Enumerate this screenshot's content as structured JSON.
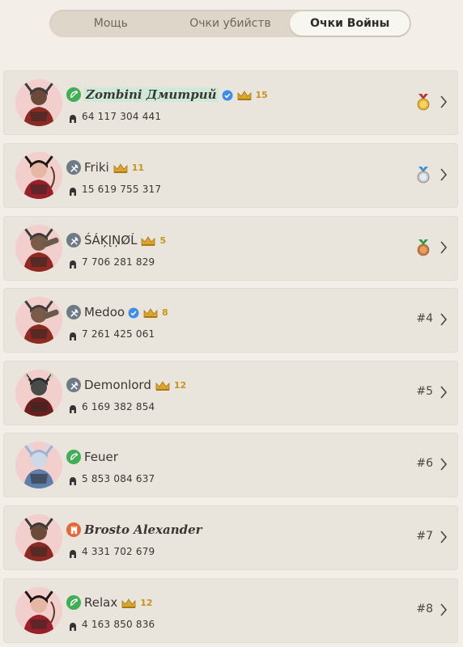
{
  "tabs": [
    {
      "label": "Мощь",
      "active": false
    },
    {
      "label": "Очки убийств",
      "active": false
    },
    {
      "label": "Очки Войны",
      "active": true
    }
  ],
  "players": [
    {
      "name": "Zombini Дмитрий",
      "score": "64 117 304 441",
      "level": "15",
      "rank": "",
      "medal": "gold",
      "class": "archer",
      "class_color": "#3fae55",
      "verified": true,
      "crown": true,
      "avatar": "horned-warrior",
      "name_style": "fancy-highlight"
    },
    {
      "name": "Friki",
      "score": "15 619 755 317",
      "level": "11",
      "rank": "",
      "medal": "silver",
      "class": "axe",
      "class_color": "#6e7b86",
      "verified": false,
      "crown": true,
      "avatar": "red-archer",
      "name_style": "plain"
    },
    {
      "name": "ŚÁĶĮŅØĹ",
      "score": "7 706 281 829",
      "level": "5",
      "rank": "",
      "medal": "bronze",
      "class": "axe",
      "class_color": "#6e7b86",
      "verified": false,
      "crown": true,
      "avatar": "cannon-warrior",
      "name_style": "plain"
    },
    {
      "name": "Medoo",
      "score": "7 261 425 061",
      "level": "8",
      "rank": "#4",
      "medal": "",
      "class": "axe",
      "class_color": "#6e7b86",
      "verified": true,
      "crown": true,
      "avatar": "cannon-warrior",
      "name_style": "plain"
    },
    {
      "name": "Demonlord",
      "score": "6 169 382 854",
      "level": "12",
      "rank": "#5",
      "medal": "",
      "class": "axe",
      "class_color": "#6e7b86",
      "verified": false,
      "crown": true,
      "avatar": "minotaur",
      "name_style": "plain"
    },
    {
      "name": "Feuer",
      "score": "5 853 084 637",
      "level": "",
      "rank": "#6",
      "medal": "",
      "class": "archer",
      "class_color": "#3fae55",
      "verified": false,
      "crown": false,
      "avatar": "blue-warrior",
      "name_style": "plain"
    },
    {
      "name": "Brosto Alexander",
      "score": "4 331 702 679",
      "level": "",
      "rank": "#7",
      "medal": "",
      "class": "tower",
      "class_color": "#e4683a",
      "verified": false,
      "crown": false,
      "avatar": "horned-warrior",
      "name_style": "fancy"
    },
    {
      "name": "Relax",
      "score": "4 163 850 836",
      "level": "12",
      "rank": "#8",
      "medal": "",
      "class": "archer",
      "class_color": "#3fae55",
      "verified": false,
      "crown": true,
      "avatar": "red-archer",
      "name_style": "plain"
    }
  ],
  "colors": {
    "background": "#f3efe8",
    "row": "#e9e4dc",
    "crown": "#c9931f",
    "verified": "#3c8ee8",
    "avatar_bg": "#f2cfcd"
  }
}
